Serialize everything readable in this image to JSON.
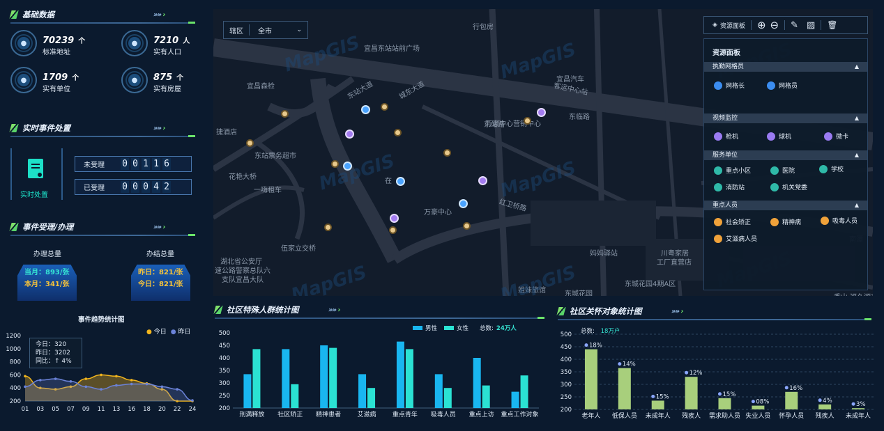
{
  "sections": {
    "basic": "基础数据",
    "realtime": "实时事件处置",
    "events": "事件受理/办理",
    "special": "社区特殊人群统计图",
    "care": "社区关怀对象统计图"
  },
  "stats": [
    {
      "value": "70239",
      "unit": "个",
      "label": "标准地址",
      "icon": "location-icon"
    },
    {
      "value": "7210",
      "unit": "人",
      "label": "实有人口",
      "icon": "person-icon"
    },
    {
      "value": "1709",
      "unit": "个",
      "label": "实有单位",
      "icon": "building-icon"
    },
    {
      "value": "875",
      "unit": "个",
      "label": "实有房屋",
      "icon": "house-icon"
    }
  ],
  "realtime": {
    "label": "实时处置",
    "rows": [
      {
        "label": "未受理",
        "digits": [
          "0",
          "0",
          "1",
          "1",
          "6"
        ]
      },
      {
        "label": "已受理",
        "digits": [
          "0",
          "0",
          "0",
          "4",
          "2"
        ]
      }
    ]
  },
  "events": {
    "total_label": "办理总量",
    "done_label": "办结总量",
    "month": "当月：893/张",
    "this_month": "本月：341/张",
    "yesterday": "昨日：821/张",
    "today": "今日：821/张"
  },
  "trend": {
    "title": "事件趋势统计图",
    "legend": [
      "今日",
      "昨日"
    ],
    "tooltip": [
      "今日：320",
      "昨日：3202",
      "同比：↑ 4%"
    ],
    "chart_data": {
      "type": "area",
      "title": "事件趋势统计图",
      "x": [
        "01",
        "03",
        "05",
        "07",
        "09",
        "11",
        "13",
        "16",
        "18",
        "20",
        "22",
        "24"
      ],
      "ylim": [
        200,
        1200
      ],
      "yticks": [
        "1200",
        "1000",
        "800",
        "600",
        "400",
        "200"
      ],
      "series": [
        {
          "name": "今日",
          "color": "#f2b51d",
          "values": [
            580,
            400,
            380,
            420,
            540,
            600,
            580,
            520,
            470,
            380,
            200,
            200
          ]
        },
        {
          "name": "昨日",
          "color": "#6b83d9",
          "values": [
            420,
            520,
            540,
            500,
            420,
            380,
            440,
            460,
            460,
            420,
            380,
            210
          ]
        }
      ]
    }
  },
  "map": {
    "district_label": "辖区",
    "district_value": "全市",
    "toolbar_label": "资源面板",
    "labels": [
      "宜昌东站站前广场",
      "行包房",
      "宜昌森检",
      "城东大道",
      "东临路",
      "宜昌汽车",
      "客运中心站",
      "东站大道",
      "东站路",
      "万豪中心营销中心",
      "捷酒店",
      "东站票务超市",
      "花艳大桥",
      "一嗨租车",
      "在",
      "万豪中心",
      "红卫桥路",
      "伍家立交桥",
      "湖北省公安厅",
      "速公路警察总队六",
      "支队宜昌大队",
      "妈妈驿站",
      "川粤家居",
      "工厂直营店",
      "姐妹旅馆",
      "东城花园",
      "东城花园4期A区",
      "香山·福久源东区",
      "南潭"
    ],
    "watermark": "MapGIS"
  },
  "panel": {
    "title": "资源面板",
    "groups": [
      {
        "title": "执勤网格员",
        "items": [
          "网格长",
          "网格员"
        ]
      },
      {
        "title": "视频监控",
        "items": [
          "枪机",
          "球机",
          "微卡"
        ]
      },
      {
        "title": "服务单位",
        "items": [
          "重点小区",
          "医院",
          "学校",
          "消防站",
          "机关党委"
        ]
      },
      {
        "title": "重点人员",
        "items": [
          "社会矫正",
          "精神病",
          "吸毒人员",
          "艾滋病人员"
        ]
      }
    ]
  },
  "special_chart": {
    "legend": [
      "男性",
      "女性"
    ],
    "total_label": "总数:",
    "total_value": "24万人",
    "chart_data": {
      "type": "bar",
      "categories": [
        "刑满释放",
        "社区矫正",
        "精神患者",
        "艾滋病",
        "重点青年",
        "吸毒人员",
        "重点上访",
        "重点工作对象"
      ],
      "ylim": [
        200,
        500
      ],
      "yticks": [
        "500",
        "450",
        "400",
        "350",
        "300",
        "250",
        "200"
      ],
      "series": [
        {
          "name": "男性",
          "color": "#19b6f0",
          "values": [
            335,
            435,
            450,
            335,
            465,
            335,
            400,
            265
          ]
        },
        {
          "name": "女性",
          "color": "#2be2d3",
          "values": [
            435,
            295,
            440,
            280,
            435,
            280,
            290,
            330
          ]
        }
      ]
    }
  },
  "care_chart": {
    "total_label": "总数:",
    "total_value": "18万户",
    "chart_data": {
      "type": "bar",
      "categories": [
        "老年人",
        "低保人员",
        "未成年人",
        "残疾人",
        "需求助人员",
        "失业人员",
        "怀孕人员",
        "残疾人",
        "未成年人"
      ],
      "ylim": [
        200,
        500
      ],
      "yticks": [
        "500",
        "450",
        "400",
        "350",
        "300",
        "250",
        "200"
      ],
      "values": [
        440,
        365,
        235,
        330,
        245,
        215,
        270,
        220,
        205
      ],
      "labels": [
        "18%",
        "14%",
        "15%",
        "12%",
        "15%",
        "08%",
        "16%",
        "4%",
        "3%"
      ]
    }
  }
}
